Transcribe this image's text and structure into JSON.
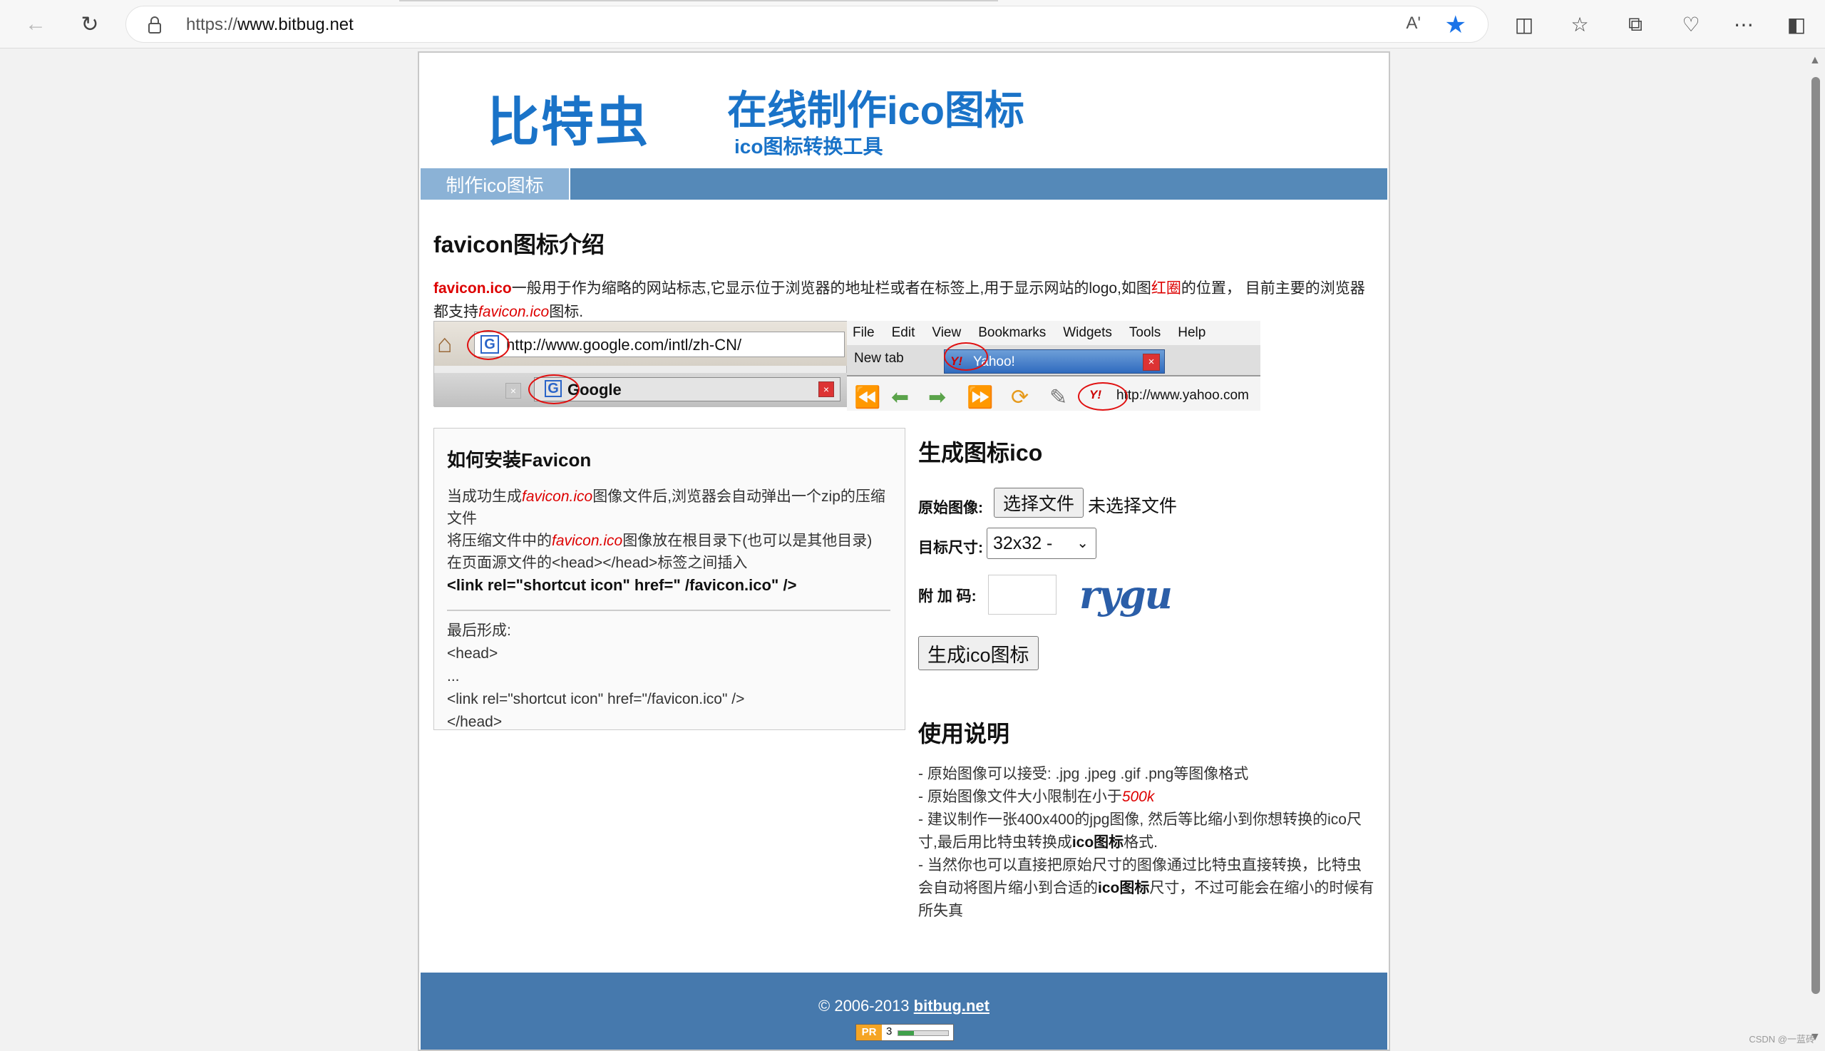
{
  "browser": {
    "url_prefix": "https://",
    "url_host": "www.bitbug.net",
    "read_aloud": "A'",
    "icons": [
      "back-icon",
      "refresh-icon",
      "lock-icon",
      "read-aloud-icon",
      "favorite-star-icon",
      "split-screen-icon",
      "favorites-icon",
      "collections-icon",
      "performance-icon",
      "more-icon",
      "sidebar-icon"
    ]
  },
  "header": {
    "logo": "比特虫",
    "title": "在线制作ico图标",
    "subtitle": "ico图标转换工具"
  },
  "nav": {
    "tab1": "制作ico图标"
  },
  "intro": {
    "heading": "favicon图标介绍",
    "lead": "favicon.ico",
    "text1": "一般用于作为缩略的网站标志,它显示位于浏览器的地址栏或者在标签上,用于显示网站的logo,如图",
    "red_circle": "红圈",
    "text2": "的位置， 目前主要的浏览器都支持",
    "italic_file": "favicon.ico",
    "text3": "图标."
  },
  "illustration": {
    "google_url": "http://www.google.com/intl/zh-CN/",
    "google_tab": "Google",
    "menu": [
      "File",
      "Edit",
      "View",
      "Bookmarks",
      "Widgets",
      "Tools",
      "Help"
    ],
    "new_tab": "New tab",
    "yahoo_tab": "Yahoo!",
    "yahoo_url": "http://www.yahoo.com"
  },
  "howto": {
    "heading": "如何安装Favicon",
    "s1a": "当成功生成",
    "s1file": "favicon.ico",
    "s1b": "图像文件后,浏览器会自动弹出一个zip的压缩文件",
    "s2a": "将压缩文件中的",
    "s2file": "favicon.ico",
    "s2b": "图像放在根目录下(也可以是其他目录)",
    "s3": "在页面源文件的<head></head>标签之间插入",
    "code": "<link rel=\"shortcut icon\" href=\" /favicon.ico\" />",
    "r1": "最后形成:",
    "r2": "<head>",
    "r3": "...",
    "r4": "<link rel=\"shortcut icon\" href=\"/favicon.ico\" />",
    "r5": "</head>"
  },
  "form": {
    "heading": "生成图标ico",
    "source_label": "原始图像:",
    "choose_file": "选择文件",
    "no_file": "未选择文件",
    "size_label": "目标尺寸:",
    "size_value": "32x32 -",
    "code_label": "附 加 码:",
    "captcha": "rygu",
    "submit": "生成ico图标"
  },
  "usage": {
    "heading": "使用说明",
    "l1": "- 原始图像可以接受: .jpg .jpeg .gif .png等图像格式",
    "l2a": "- 原始图像文件大小限制在小于",
    "l2b": "500k",
    "l3a": "- 建议制作一张400x400的jpg图像, 然后等比缩小到你想转换的ico尺寸,最后用比特虫转换成",
    "l3b": "ico图标",
    "l3c": "格式.",
    "l4a": "- 当然你也可以直接把原始尺寸的图像通过比特虫直接转换，比特虫会自动将图片缩小到合适的",
    "l4b": "ico图标",
    "l4c": "尺寸，不过可能会在缩小的时候有所失真"
  },
  "footer": {
    "copy": "© 2006-2013 ",
    "link": "bitbug.net",
    "pr_label": "PR",
    "pr_value": "3"
  },
  "watermark": "CSDN @一蓝砖"
}
